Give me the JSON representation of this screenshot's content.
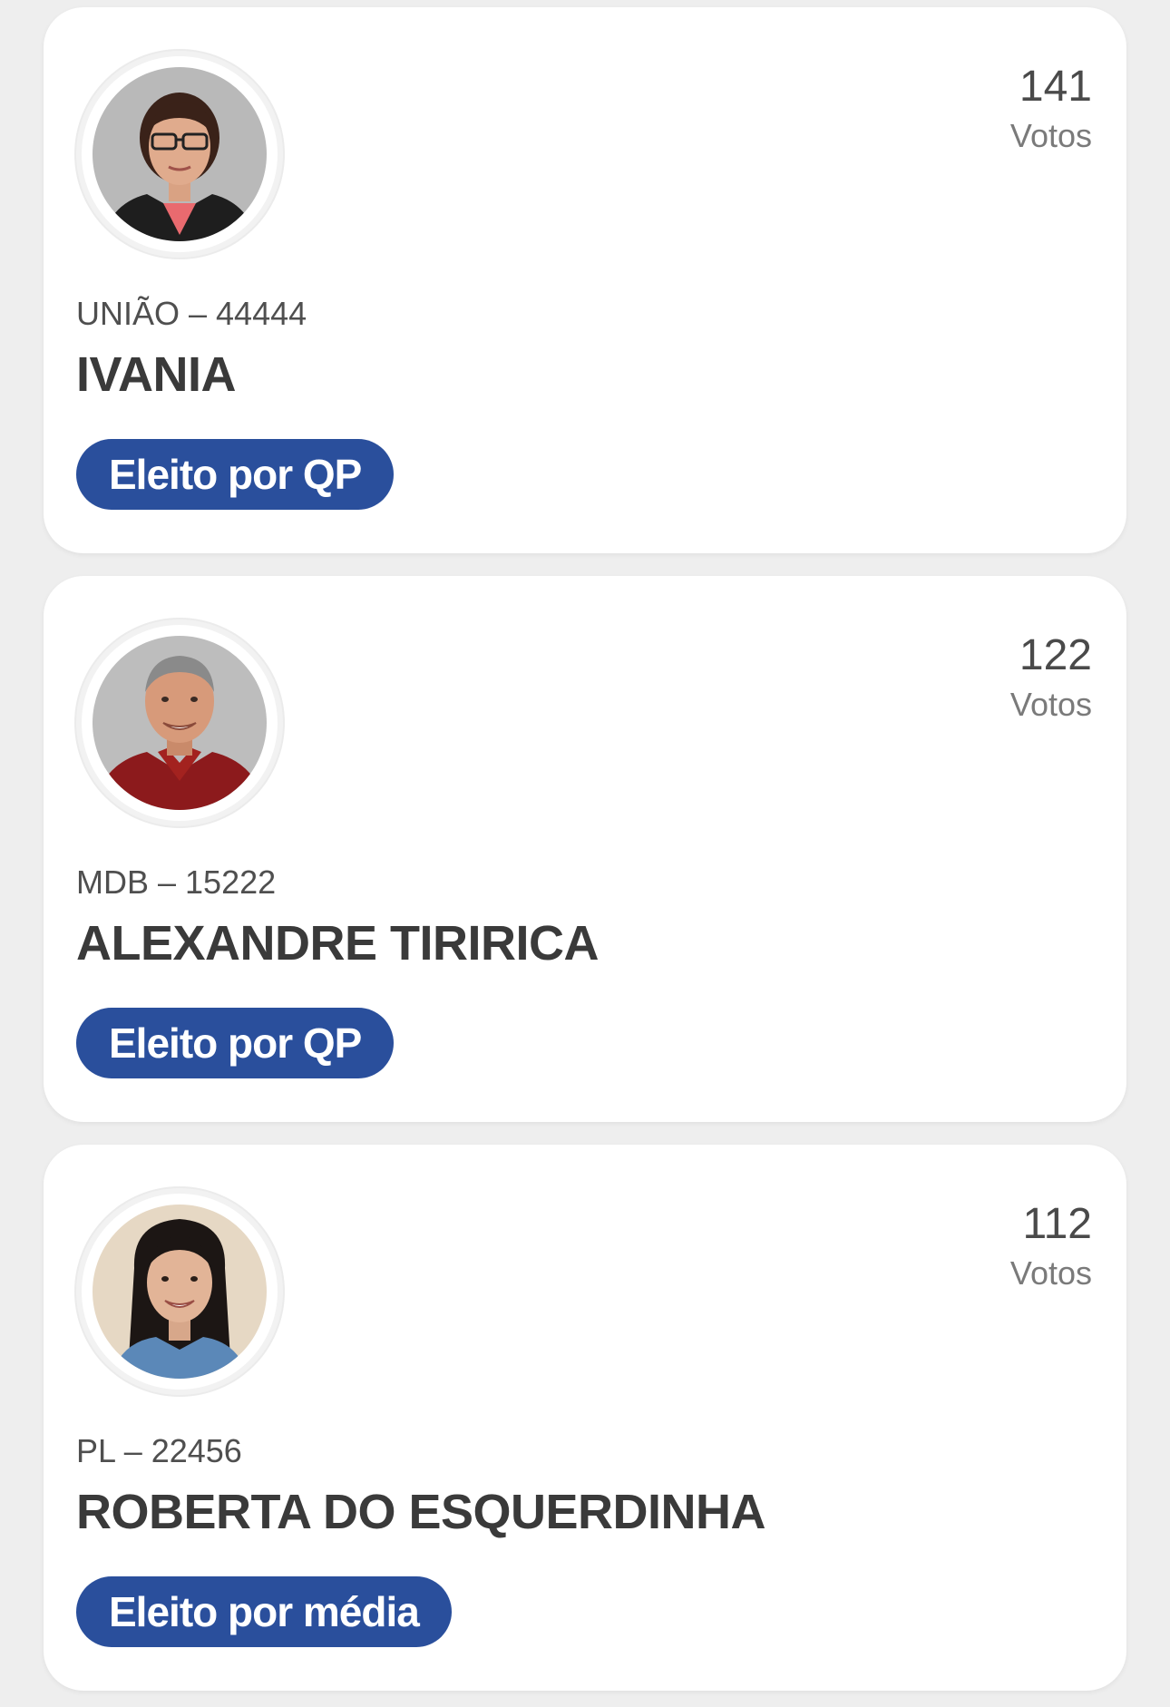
{
  "candidates": [
    {
      "party_number": "UNIÃO – 44444",
      "name": "IVANIA",
      "votes": "141",
      "votes_label": "Votos",
      "status": "Eleito por QP"
    },
    {
      "party_number": "MDB – 15222",
      "name": "ALEXANDRE TIRIRICA",
      "votes": "122",
      "votes_label": "Votos",
      "status": "Eleito por QP"
    },
    {
      "party_number": "PL – 22456",
      "name": "ROBERTA DO ESQUERDINHA",
      "votes": "112",
      "votes_label": "Votos",
      "status": "Eleito por média"
    }
  ],
  "colors": {
    "badge_background": "#2a4f9c",
    "page_background": "#eeeeee",
    "card_background": "#ffffff"
  }
}
